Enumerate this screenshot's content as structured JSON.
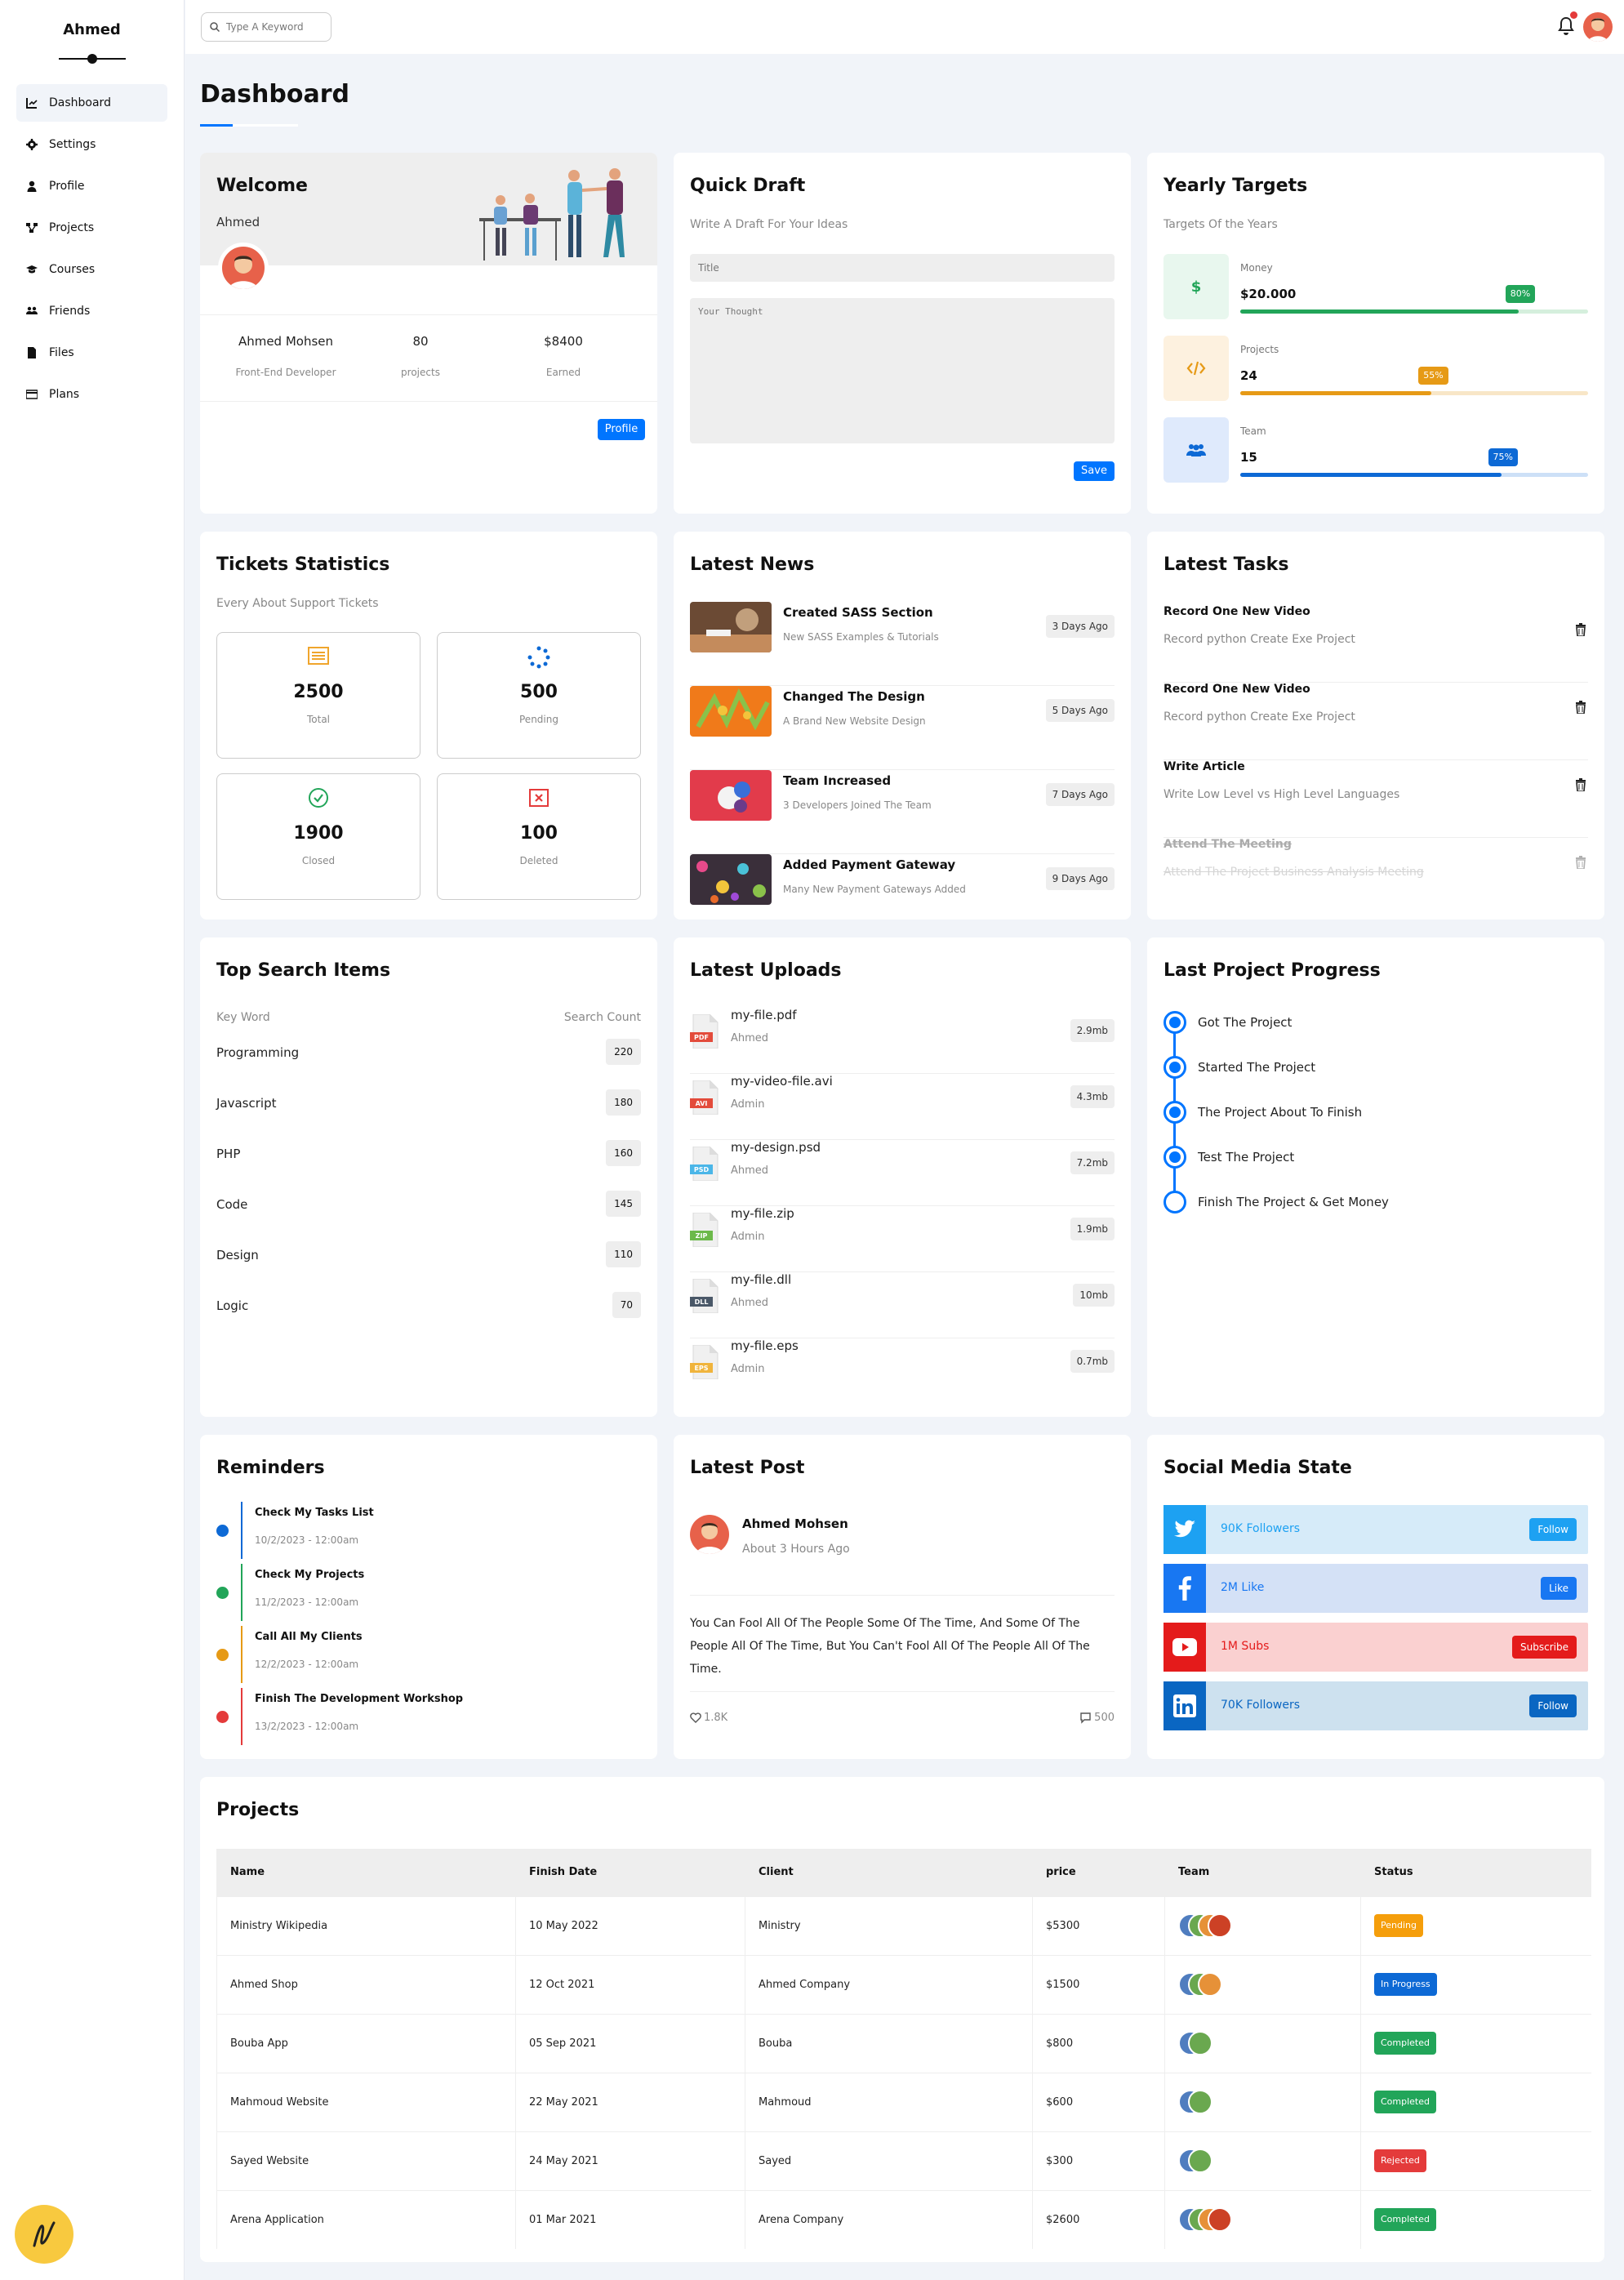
{
  "sidebar": {
    "brand": "Ahmed",
    "items": [
      {
        "label": "Dashboard",
        "icon": "chart-icon"
      },
      {
        "label": "Settings",
        "icon": "gear-icon"
      },
      {
        "label": "Profile",
        "icon": "user-icon"
      },
      {
        "label": "Projects",
        "icon": "diagram-icon"
      },
      {
        "label": "Courses",
        "icon": "graduation-cap-icon"
      },
      {
        "label": "Friends",
        "icon": "users-icon"
      },
      {
        "label": "Files",
        "icon": "file-icon"
      },
      {
        "label": "Plans",
        "icon": "credit-card-icon"
      }
    ]
  },
  "header": {
    "search_placeholder": "Type A Keyword"
  },
  "page": {
    "title": "Dashboard"
  },
  "welcome": {
    "title": "Welcome",
    "name": "Ahmed",
    "stats": [
      {
        "value": "Ahmed Mohsen",
        "label": "Front-End Developer"
      },
      {
        "value": "80",
        "label": "projects"
      },
      {
        "value": "$8400",
        "label": "Earned"
      }
    ],
    "button": "Profile"
  },
  "draft": {
    "title": "Quick Draft",
    "subtitle": "Write A Draft For Your Ideas",
    "title_placeholder": "Title",
    "thought_placeholder": "Your Thought",
    "button": "Save"
  },
  "targets": {
    "title": "Yearly Targets",
    "subtitle": "Targets Of the Years",
    "items": [
      {
        "label": "Money",
        "value": "$20.000",
        "percent": "80%",
        "fill": 0.8,
        "color": "#22a559",
        "bg": "#e8f7ee",
        "track": "#d5efdd"
      },
      {
        "label": "Projects",
        "value": "24",
        "percent": "55%",
        "fill": 0.55,
        "color": "#e69a16",
        "bg": "#fdf1df",
        "track": "#f8e6c7"
      },
      {
        "label": "Team",
        "value": "15",
        "percent": "75%",
        "fill": 0.75,
        "color": "#0d69d5",
        "bg": "#dfeafc",
        "track": "#cde0f7"
      }
    ]
  },
  "tickets": {
    "title": "Tickets Statistics",
    "subtitle": "Every About Support Tickets",
    "items": [
      {
        "value": "2500",
        "label": "Total"
      },
      {
        "value": "500",
        "label": "Pending"
      },
      {
        "value": "1900",
        "label": "Closed"
      },
      {
        "value": "100",
        "label": "Deleted"
      }
    ]
  },
  "news": {
    "title": "Latest News",
    "items": [
      {
        "title": "Created SASS Section",
        "subtitle": "New SASS Examples & Tutorials",
        "time": "3 Days Ago"
      },
      {
        "title": "Changed The Design",
        "subtitle": "A Brand New Website Design",
        "time": "5 Days Ago"
      },
      {
        "title": "Team Increased",
        "subtitle": "3 Developers Joined The Team",
        "time": "7 Days Ago"
      },
      {
        "title": "Added Payment Gateway",
        "subtitle": "Many New Payment Gateways Added",
        "time": "9 Days Ago"
      }
    ]
  },
  "tasks": {
    "title": "Latest Tasks",
    "items": [
      {
        "title": "Record One New Video",
        "subtitle": "Record python Create Exe Project"
      },
      {
        "title": "Record One New Video",
        "subtitle": "Record python Create Exe Project"
      },
      {
        "title": "Write Article",
        "subtitle": "Write Low Level vs High Level Languages"
      },
      {
        "title": "Attend The Meeting",
        "subtitle": "Attend The Project Business Analysis Meeting"
      }
    ]
  },
  "search_items": {
    "title": "Top Search Items",
    "col_key": "Key Word",
    "col_count": "Search Count",
    "rows": [
      {
        "key": "Programming",
        "count": "220"
      },
      {
        "key": "Javascript",
        "count": "180"
      },
      {
        "key": "PHP",
        "count": "160"
      },
      {
        "key": "Code",
        "count": "145"
      },
      {
        "key": "Design",
        "count": "110"
      },
      {
        "key": "Logic",
        "count": "70"
      }
    ]
  },
  "uploads": {
    "title": "Latest Uploads",
    "items": [
      {
        "name": "my-file.pdf",
        "by": "Ahmed",
        "size": "2.9mb",
        "ext": "PDF",
        "color": "#e34b3b"
      },
      {
        "name": "my-video-file.avi",
        "by": "Admin",
        "size": "4.3mb",
        "ext": "AVI",
        "color": "#e34b3b"
      },
      {
        "name": "my-design.psd",
        "by": "Ahmed",
        "size": "7.2mb",
        "ext": "PSD",
        "color": "#4bb6e8"
      },
      {
        "name": "my-file.zip",
        "by": "Admin",
        "size": "1.9mb",
        "ext": "ZIP",
        "color": "#6cb94a"
      },
      {
        "name": "my-file.dll",
        "by": "Ahmed",
        "size": "10mb",
        "ext": "DLL",
        "color": "#4a5868"
      },
      {
        "name": "my-file.eps",
        "by": "Admin",
        "size": "0.7mb",
        "ext": "EPS",
        "color": "#f0b43c"
      }
    ]
  },
  "progress": {
    "title": "Last Project Progress",
    "steps": [
      "Got The Project",
      "Started The Project",
      "The Project About To Finish",
      "Test The Project",
      "Finish The Project & Get Money"
    ]
  },
  "reminders": {
    "title": "Reminders",
    "items": [
      {
        "title": "Check My Tasks List",
        "date": "10/2/2023 - 12:00am",
        "color": "#0d69d5"
      },
      {
        "title": "Check My Projects",
        "date": "11/2/2023 - 12:00am",
        "color": "#22a559"
      },
      {
        "title": "Call All My Clients",
        "date": "12/2/2023 - 12:00am",
        "color": "#e69a16"
      },
      {
        "title": "Finish The Development Workshop",
        "date": "13/2/2023 - 12:00am",
        "color": "#e43b3b"
      }
    ]
  },
  "post": {
    "title": "Latest Post",
    "author": "Ahmed Mohsen",
    "time": "About 3 Hours Ago",
    "body": "You Can Fool All Of The People Some Of The Time, And Some Of The People All Of The Time, But You Can't Fool All Of The People All Of The Time.",
    "likes": "1.8K",
    "comments": "500"
  },
  "social": {
    "title": "Social Media State",
    "items": [
      {
        "text": "90K Followers",
        "button": "Follow",
        "icon": "twitter-icon",
        "bg": "#d6ebf9",
        "main": "#1da1f2",
        "text_color": "#1da1f2"
      },
      {
        "text": "2M Like",
        "button": "Like",
        "icon": "facebook-icon",
        "bg": "#d4e1f6",
        "main": "#1877f2",
        "text_color": "#1877f2"
      },
      {
        "text": "1M Subs",
        "button": "Subscribe",
        "icon": "youtube-icon",
        "bg": "#fad0d0",
        "main": "#e41b1b",
        "text_color": "#e41b1b"
      },
      {
        "text": "70K Followers",
        "button": "Follow",
        "icon": "linkedin-icon",
        "bg": "#cde1ef",
        "main": "#0a66c2",
        "text_color": "#0a66c2"
      }
    ]
  },
  "projects": {
    "title": "Projects",
    "columns": [
      "Name",
      "Finish Date",
      "Client",
      "price",
      "Team",
      "Status"
    ],
    "rows": [
      {
        "name": "Ministry Wikipedia",
        "date": "10 May 2022",
        "client": "Ministry",
        "price": "$5300",
        "team": 4,
        "status": "Pending",
        "color": "#f59e0b"
      },
      {
        "name": "Ahmed Shop",
        "date": "12 Oct 2021",
        "client": "Ahmed Company",
        "price": "$1500",
        "team": 3,
        "status": "In Progress",
        "color": "#0d69d5"
      },
      {
        "name": "Bouba App",
        "date": "05 Sep 2021",
        "client": "Bouba",
        "price": "$800",
        "team": 2,
        "status": "Completed",
        "color": "#22a559"
      },
      {
        "name": "Mahmoud Website",
        "date": "22 May 2021",
        "client": "Mahmoud",
        "price": "$600",
        "team": 2,
        "status": "Completed",
        "color": "#22a559"
      },
      {
        "name": "Sayed Website",
        "date": "24 May 2021",
        "client": "Sayed",
        "price": "$300",
        "team": 2,
        "status": "Rejected",
        "color": "#e43b3b"
      },
      {
        "name": "Arena Application",
        "date": "01 Mar 2021",
        "client": "Arena Company",
        "price": "$2600",
        "team": 4,
        "status": "Completed",
        "color": "#22a559"
      }
    ]
  }
}
